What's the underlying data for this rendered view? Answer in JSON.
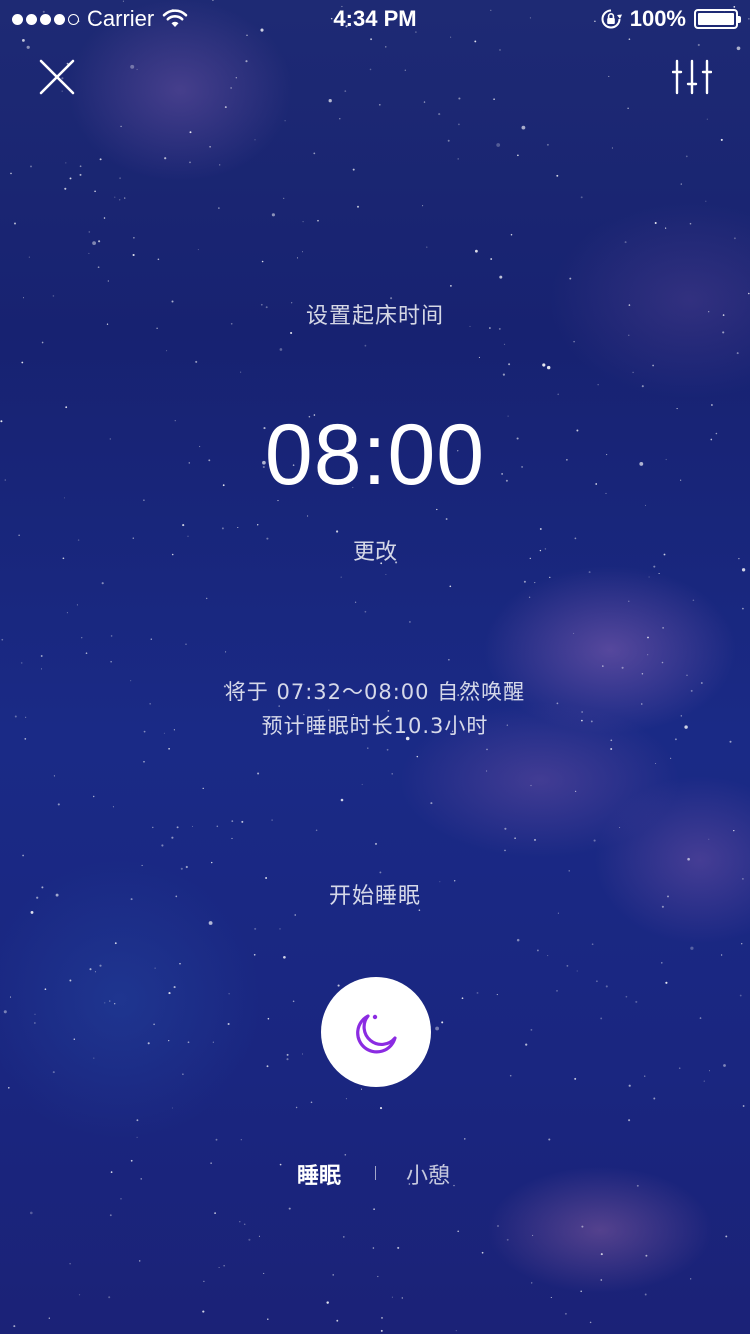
{
  "status_bar": {
    "carrier": "Carrier",
    "time": "4:34 PM",
    "battery": "100%",
    "battery_level": 1.0,
    "signal_bars_filled": 4,
    "signal_bars_total": 5,
    "icons": [
      "signal-dots-icon",
      "wifi-icon",
      "rotation-lock-icon",
      "battery-icon"
    ]
  },
  "header": {
    "close_icon": "close-icon",
    "settings_icon": "sliders-icon"
  },
  "alarm": {
    "title": "设置起床时间",
    "time": "08:00",
    "change_label": "更改"
  },
  "summary": {
    "wake_window": "将于 07:32～08:00 自然唤醒",
    "estimated_duration": "预计睡眠时长10.3小时"
  },
  "start": {
    "label": "开始睡眠",
    "button_icon": "moon-icon"
  },
  "mode_tabs": {
    "items": [
      {
        "label": "睡眠",
        "selected": true
      },
      {
        "label": "小憩",
        "selected": false
      }
    ]
  },
  "colors": {
    "background_top": "#1e2a74",
    "background_bottom": "#1b2277",
    "moon_icon": "#8b2be2",
    "text": "#ffffff"
  }
}
